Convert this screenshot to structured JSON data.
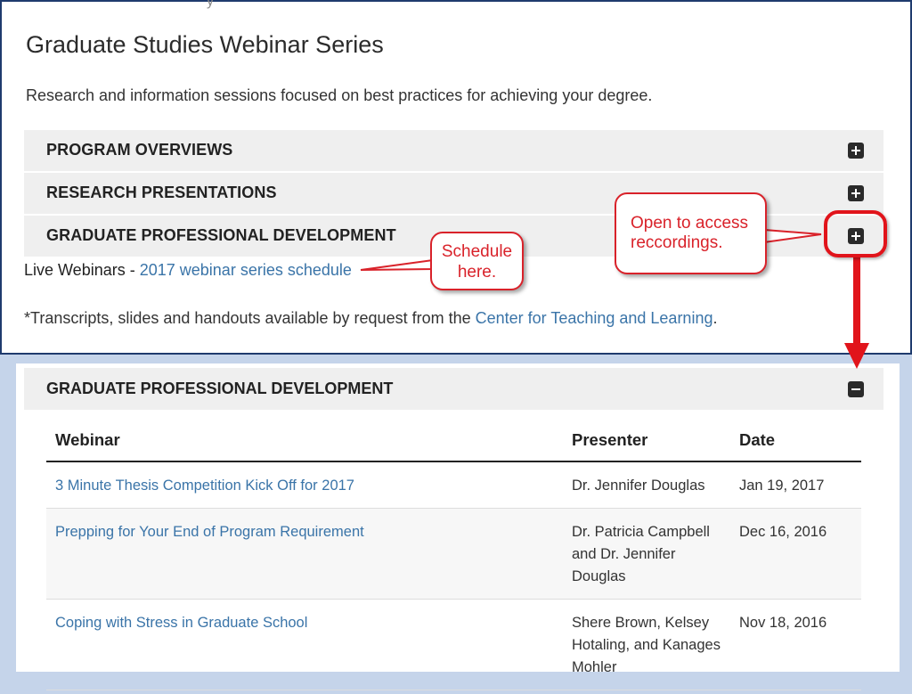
{
  "page": {
    "cut_text": "y",
    "title": "Graduate Studies Webinar Series",
    "description": "Research and information sessions focused on best practices for achieving your degree."
  },
  "accordions": [
    {
      "label": "PROGRAM OVERVIEWS",
      "icon": "plus-box-icon"
    },
    {
      "label": "RESEARCH PRESENTATIONS",
      "icon": "plus-box-icon"
    },
    {
      "label": "GRADUATE PROFESSIONAL DEVELOPMENT",
      "icon": "plus-box-icon"
    }
  ],
  "live": {
    "label": "Live Webinars",
    "separator": " - ",
    "link_text": "2017 webinar series schedule"
  },
  "note": {
    "prefix": "*Transcripts, slides and handouts available by request from the ",
    "link_text": "Center for Teaching and Learning",
    "suffix": "."
  },
  "expanded": {
    "label": "GRADUATE PROFESSIONAL DEVELOPMENT",
    "icon": "minus-box-icon",
    "columns": [
      "Webinar",
      "Presenter",
      "Date"
    ],
    "rows": [
      {
        "webinar": "3 Minute Thesis Competition Kick Off for 2017",
        "presenter": "Dr. Jennifer Douglas",
        "date": "Jan 19, 2017"
      },
      {
        "webinar": "Prepping for Your End of Program Requirement",
        "presenter": "Dr. Patricia Campbell and Dr. Jennifer Douglas",
        "date": "Dec 16, 2016"
      },
      {
        "webinar": "Coping with Stress in Graduate School",
        "presenter": "Shere Brown, Kelsey Hotaling, and Kanages Mohler",
        "date": "Nov 18, 2016"
      }
    ]
  },
  "annotations": {
    "schedule_callout": "Schedule here.",
    "access_callout": "Open to access reccordings."
  },
  "colors": {
    "link": "#3a74a8",
    "annotation_red": "#d9222a",
    "bottom_bg": "#c5d4ea",
    "accordion_bg": "#efefef"
  }
}
